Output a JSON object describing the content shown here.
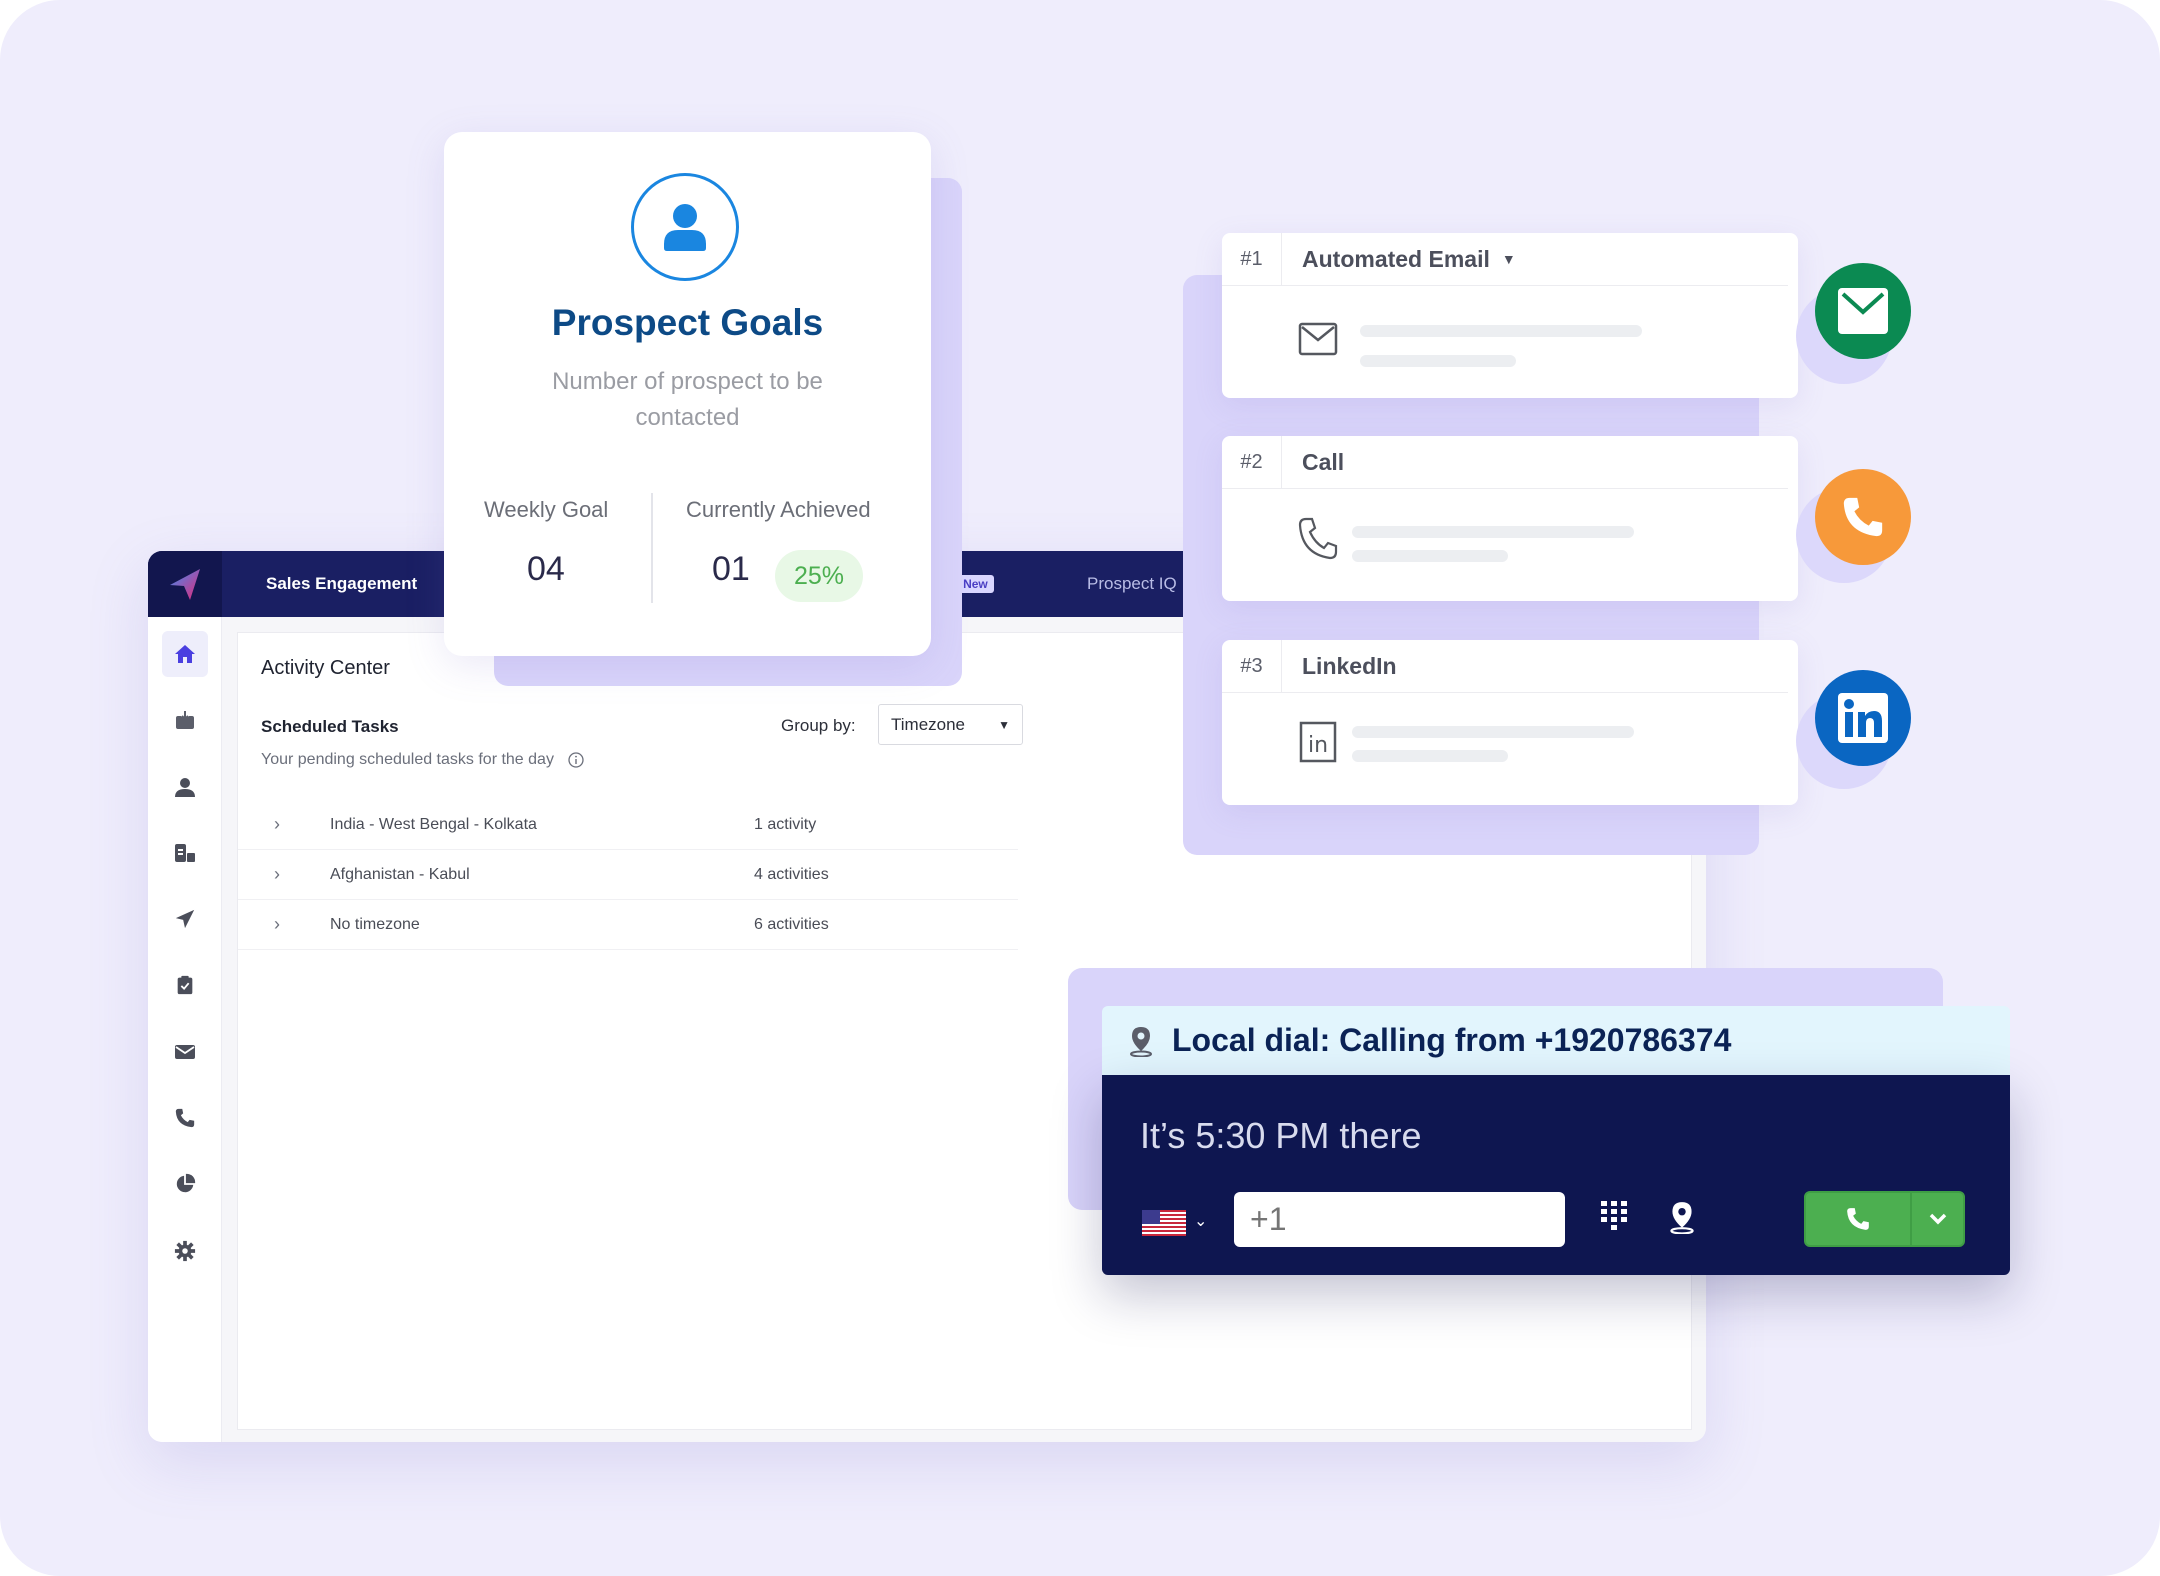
{
  "app": {
    "nav_tabs": [
      {
        "label": "Sales Engagement",
        "active": true
      },
      {
        "label": "",
        "badge": "New"
      },
      {
        "label": "Prospect IQ",
        "badge": "New"
      }
    ],
    "sidebar_icons": [
      "home-icon",
      "inbox-icon",
      "user-icon",
      "company-icon",
      "send-icon",
      "task-icon",
      "mail-icon",
      "phone-icon",
      "report-icon",
      "settings-icon"
    ],
    "activity_center": {
      "title": "Activity Center",
      "section_title": "Scheduled Tasks",
      "section_subtitle": "Your pending scheduled tasks for the day",
      "group_by_label": "Group by:",
      "group_by_value": "Timezone",
      "rows": [
        {
          "name": "India - West Bengal - Kolkata",
          "count": "1 activity"
        },
        {
          "name": "Afghanistan - Kabul",
          "count": "4 activities"
        },
        {
          "name": "No timezone",
          "count": "6 activities"
        }
      ]
    }
  },
  "prospect_goals": {
    "title": "Prospect Goals",
    "subtitle": "Number of prospect to be contacted",
    "weekly_goal_label": "Weekly Goal",
    "weekly_goal_value": "04",
    "achieved_label": "Currently Achieved",
    "achieved_value": "01",
    "achieved_percent": "25%"
  },
  "sequence": {
    "steps": [
      {
        "number": "#1",
        "title": "Automated Email",
        "has_dropdown": true,
        "icon": "mail-outline-icon",
        "channel_icon": "email-channel-icon",
        "color": "#0b8a52"
      },
      {
        "number": "#2",
        "title": "Call",
        "has_dropdown": false,
        "icon": "phone-outline-icon",
        "channel_icon": "call-channel-icon",
        "color": "#f7993a"
      },
      {
        "number": "#3",
        "title": "LinkedIn",
        "has_dropdown": false,
        "icon": "linkedin-outline-icon",
        "channel_icon": "linkedin-channel-icon",
        "color": "#0a66c2"
      }
    ]
  },
  "dialer": {
    "header": "Local dial: Calling from +1920786374",
    "local_time": "It’s 5:30 PM there",
    "country": "US",
    "phone_placeholder": "+1",
    "call_color": "#4caf50"
  }
}
